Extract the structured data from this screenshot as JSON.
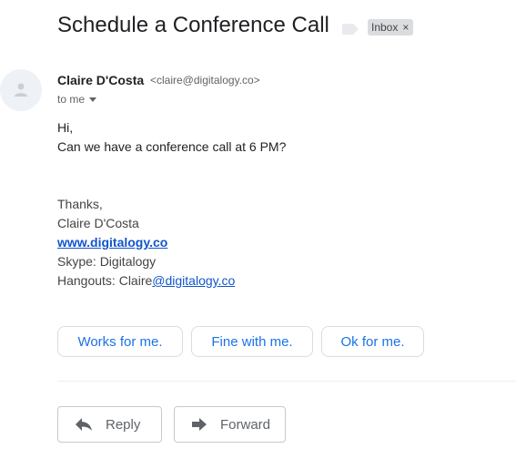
{
  "email": {
    "subject": "Schedule a Conference Call",
    "label": "Inbox",
    "label_remove": "×",
    "sender": {
      "name": "Claire D'Costa",
      "email": "<claire@digitalogy.co>"
    },
    "recipient": "to me",
    "body": {
      "greeting": "Hi,",
      "message": "Can we have a conference call at 6 PM?"
    },
    "signature": {
      "closing": "Thanks,",
      "name": "Claire D'Costa",
      "website": "www.digitalogy.co",
      "skype": "Skype: Digitalogy",
      "hangouts_prefix": "Hangouts: Claire",
      "hangouts_link": "@digitalogy.co"
    }
  },
  "smart_replies": [
    "Works for me.",
    "Fine with me.",
    "Ok for me."
  ],
  "actions": {
    "reply": "Reply",
    "forward": "Forward"
  },
  "colors": {
    "link": "#1155cc",
    "smart_reply_text": "#1a73e8",
    "label_chip_bg": "#dadce0"
  }
}
